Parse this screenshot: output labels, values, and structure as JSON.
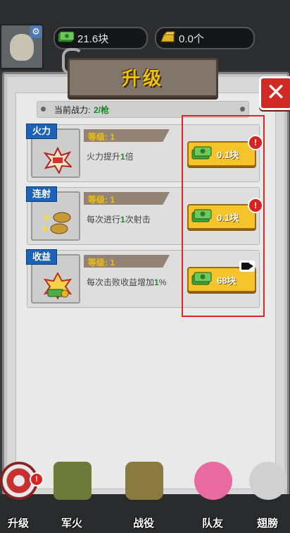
{
  "hud": {
    "cash": "21.6块",
    "gold": "0.0个"
  },
  "panel": {
    "title": "升级",
    "power_label": "当前战力:",
    "power_value": "2/枪"
  },
  "upgrades": [
    {
      "tag": "火力",
      "level": "等级: 1",
      "desc_pre": "火力提升",
      "desc_num": "1",
      "desc_post": "倍",
      "price": "0.1块",
      "badge": "alert"
    },
    {
      "tag": "连射",
      "level": "等级: 1",
      "desc_pre": "每次进行",
      "desc_num": "1",
      "desc_post": "次射击",
      "price": "0.1块",
      "badge": "alert"
    },
    {
      "tag": "收益",
      "level": "等级: 1",
      "desc_pre": "每次击败收益增加",
      "desc_num": "1",
      "desc_post": "%",
      "price": "68块",
      "badge": "video"
    }
  ],
  "nav": [
    {
      "label": "升级"
    },
    {
      "label": "军火"
    },
    {
      "label": "战役"
    },
    {
      "label": "队友"
    },
    {
      "label": "翅膀"
    }
  ],
  "colors": {
    "accent_yellow": "#f4c42a",
    "title_gold": "#f1c000",
    "tag_blue": "#1c63b7",
    "highlight_red": "#e52222",
    "positive_green": "#1c8a22"
  }
}
